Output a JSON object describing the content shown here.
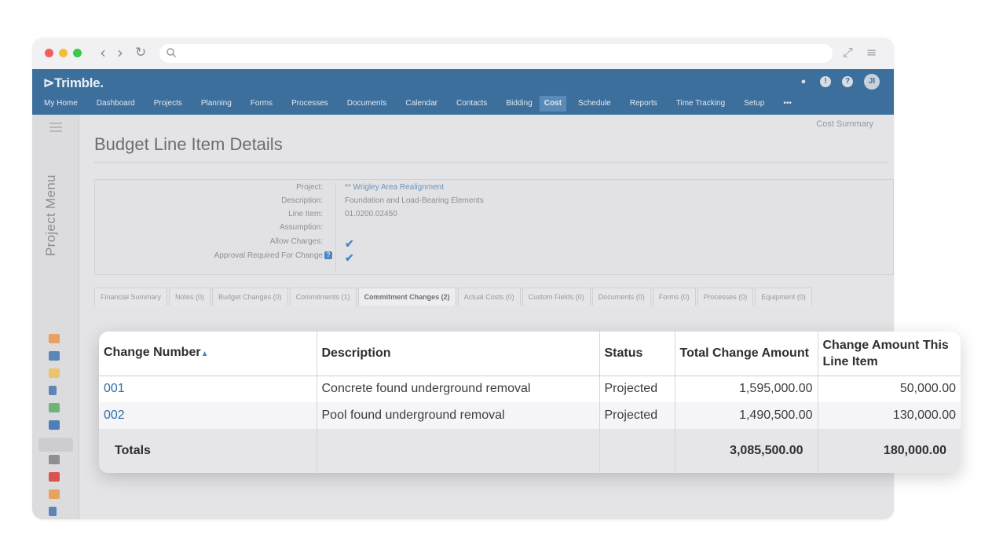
{
  "app": {
    "brand": "Trimble.",
    "menu": [
      "My Home",
      "Dashboard",
      "Projects",
      "Planning",
      "Forms",
      "Processes",
      "Documents",
      "Calendar",
      "Contacts",
      "Bidding",
      "Cost",
      "Schedule",
      "Reports",
      "Time Tracking",
      "Setup",
      "•••"
    ],
    "active_menu": "Cost",
    "side_label": "Project Menu",
    "cost_summary": "Cost Summary"
  },
  "page": {
    "title": "Budget Line Item Details",
    "fields": [
      {
        "label": "Project:",
        "value": "** Wrigley Area Realignment"
      },
      {
        "label": "Description:",
        "value": "Foundation and Load-Bearing Elements"
      },
      {
        "label": "Line Item:",
        "value": "01.0200.02450"
      },
      {
        "label": "Assumption:",
        "value": ""
      },
      {
        "label": "Allow Charges:",
        "value": "✔"
      },
      {
        "label": "Approval Required For Change",
        "value": "✔"
      }
    ],
    "tabs": [
      "Financial Summary",
      "Notes (0)",
      "Budget Changes (0)",
      "Commitments (1)",
      "Commitment Changes (2)",
      "Actual Costs (0)",
      "Custom Fields (0)",
      "Documents (0)",
      "Forms (0)",
      "Processes (0)",
      "Equipment (0)"
    ],
    "active_tab": "Commitment Changes (2)"
  },
  "table": {
    "headers": [
      "Change Number",
      "Description",
      "Status",
      "Total Change Amount",
      "Change Amount This Line Item"
    ],
    "rows": [
      {
        "number": "001",
        "description": "Concrete found underground removal",
        "status": "Projected",
        "total": "1,595,000.00",
        "line": "50,000.00"
      },
      {
        "number": "002",
        "description": "Pool found underground removal",
        "status": "Projected",
        "total": "1,490,500.00",
        "line": "130,000.00"
      }
    ],
    "totals_label": "Totals",
    "totals_total": "3,085,500.00",
    "totals_line": "180,000.00"
  }
}
